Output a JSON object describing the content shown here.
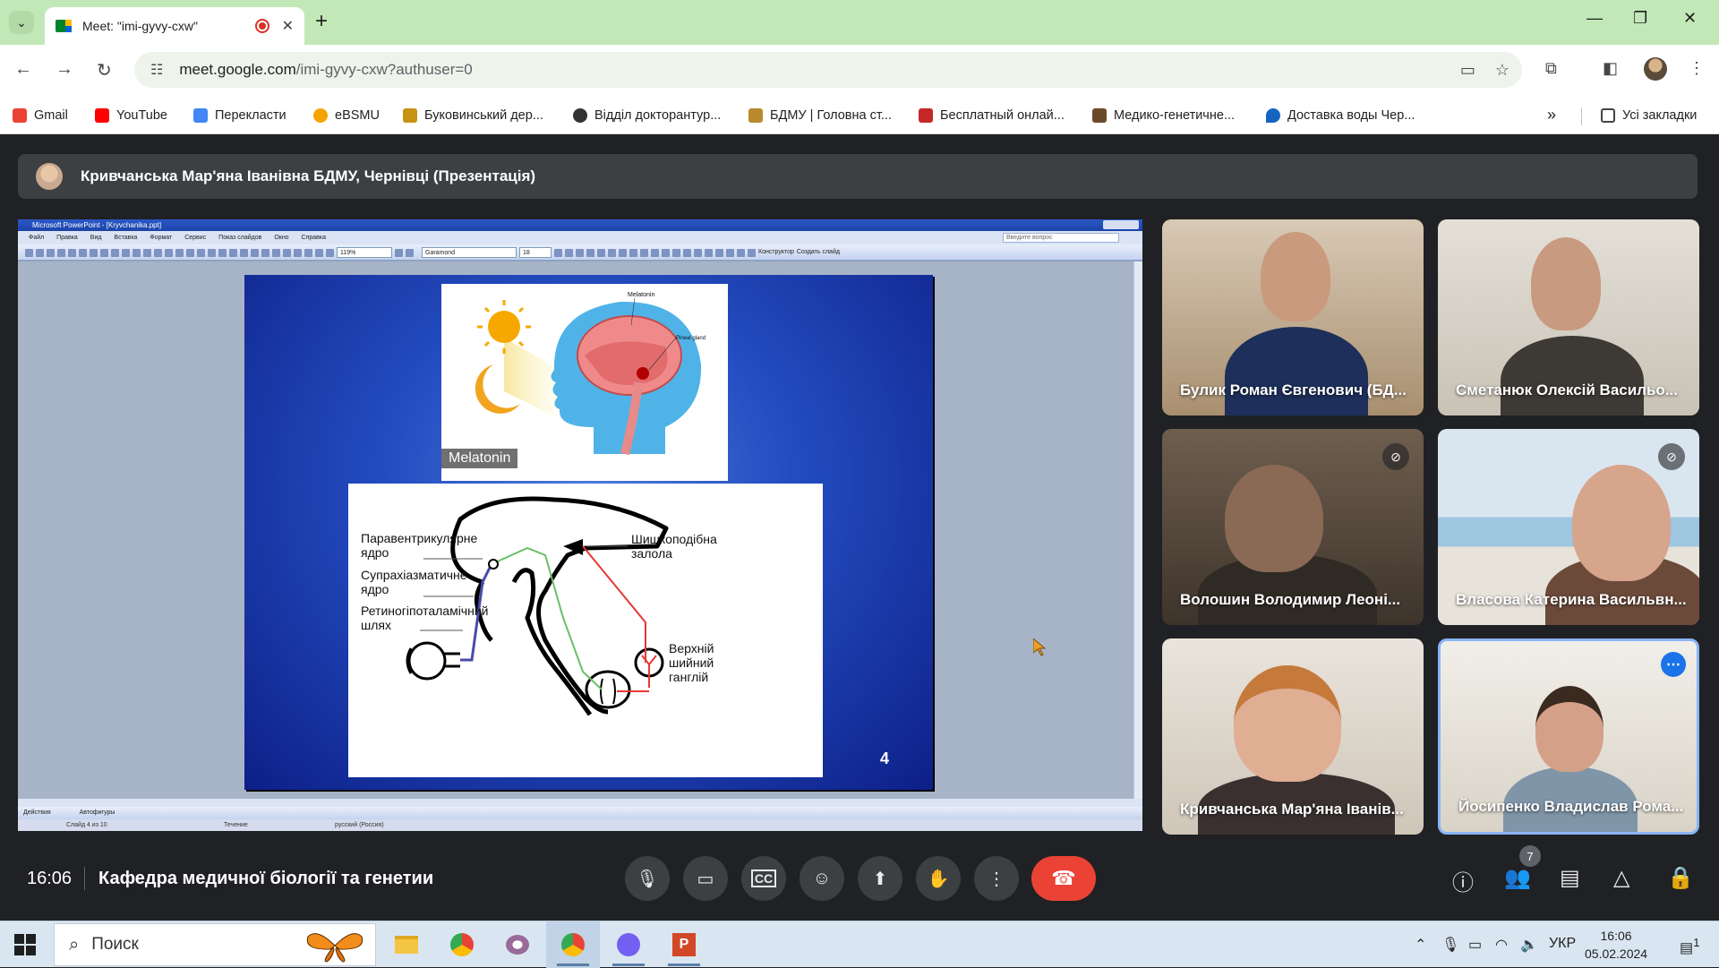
{
  "browser": {
    "tab_title": "Meet: \"imi-gyvy-cxw\"",
    "url_host": "meet.google.com",
    "url_path": "/imi-gyvy-cxw?authuser=0",
    "bookmarks": [
      {
        "label": "Gmail",
        "color": "#ea4335"
      },
      {
        "label": "YouTube",
        "color": "#ff0000"
      },
      {
        "label": "Перекласти",
        "color": "#4285f4"
      },
      {
        "label": "eBSMU",
        "color": "#f4a300"
      },
      {
        "label": "Буковинський дер...",
        "color": "#c69214"
      },
      {
        "label": "Відділ докторантур...",
        "color": "#333333"
      },
      {
        "label": "БДМУ | Головна ст...",
        "color": "#b88a2b"
      },
      {
        "label": "Бесплатный онлай...",
        "color": "#c62828"
      },
      {
        "label": "Медико-генетичне...",
        "color": "#6b4a2b"
      },
      {
        "label": "Доставка воды Чер...",
        "color": "#1565c0"
      }
    ],
    "all_bookmarks": "Усі закладки"
  },
  "meet": {
    "presenter_title": "Кривчанська Мар'яна Іванівна БДМУ, Чернівці (Презентація)",
    "clock": "16:06",
    "meeting_name": "Кафедра медичної біології та генетии",
    "participants_count": "7",
    "participants": [
      {
        "name": "Булик Роман Євгенович (БД...",
        "muted": false
      },
      {
        "name": "Сметанюк Олексій Васильо...",
        "muted": false
      },
      {
        "name": "Волошин Володимир Леоні...",
        "muted": true
      },
      {
        "name": "Власова Катерина Васильвн...",
        "muted": true
      },
      {
        "name": "Кривчанська Мар'яна Іванів...",
        "muted": false
      },
      {
        "name": "Йосипенко Владислав Рома...",
        "muted": false
      }
    ]
  },
  "ppt": {
    "window_title": "Microsoft PowerPoint - [Kryvchanika.ppt]",
    "menu": [
      "Файл",
      "Правка",
      "Вид",
      "Вставка",
      "Формат",
      "Сервис",
      "Показ слайдов",
      "Окно",
      "Справка"
    ],
    "ask_placeholder": "Введите вопрос",
    "zoom": "119%",
    "font": "Garamond",
    "font_size": "18",
    "designer": "Конструктор",
    "new_slide": "Создать слайд",
    "draw_actions": "Действия",
    "autoshapes": "Автофигуры",
    "status_slide": "Слайд 4 из 10",
    "status_design": "Течение",
    "status_lang": "русский (Россия)"
  },
  "slide": {
    "image_tag": "Melatonin",
    "image_labels": {
      "melatonin": "Melatonin",
      "pineal": "Pineal gland"
    },
    "labels": {
      "paraventricular": "Паравентрикулярне ядро",
      "suprachiasmatic": "Супрахіазматичне ядро",
      "retinohypothalamic": "Ретиногіпоталамічний шлях",
      "pineal_gland": "Шишкоподібна залола",
      "upper_cervical": "Верхній шийний ганглій"
    },
    "number": "4"
  },
  "taskbar": {
    "search_placeholder": "Поиск",
    "lang": "УКР",
    "time": "16:06",
    "date": "05.02.2024",
    "notifications": "1"
  }
}
